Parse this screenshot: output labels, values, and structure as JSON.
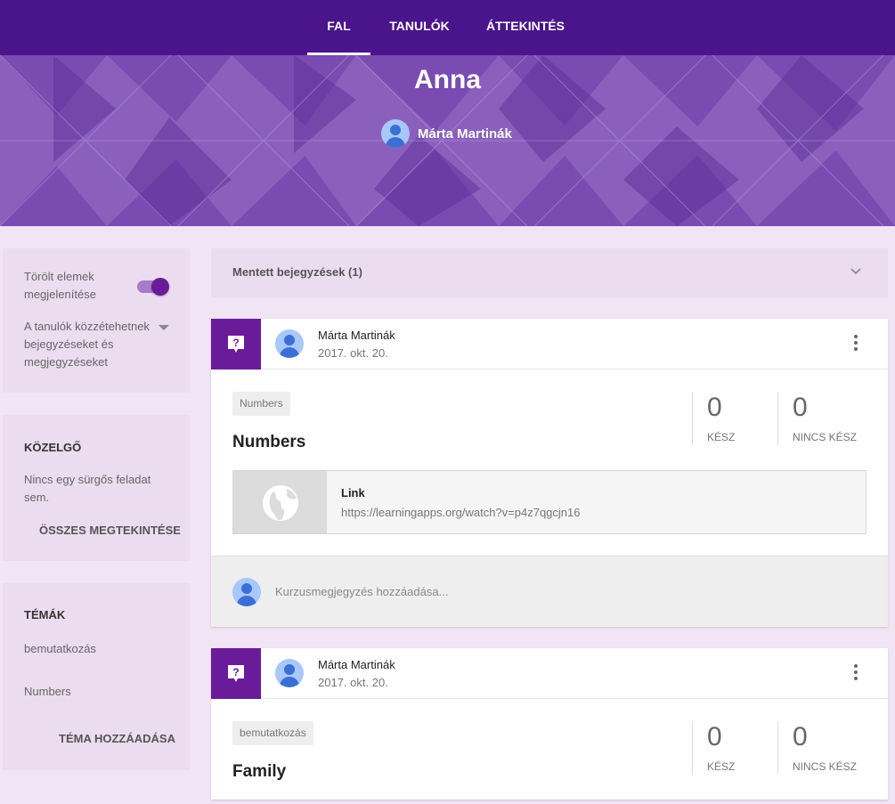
{
  "nav": {
    "tabs": [
      {
        "label": "FAL",
        "active": true
      },
      {
        "label": "TANULÓK"
      },
      {
        "label": "ÁTTEKINTÉS"
      }
    ]
  },
  "header": {
    "class_name": "Anna",
    "teacher": "Márta Martinák"
  },
  "settings": {
    "show_deleted_label": "Törölt elemek megjelenítése",
    "show_deleted_on": true,
    "permission_label": "A tanulók közzétehetnek bejegyzéseket és megjegyzéseket"
  },
  "upcoming": {
    "title": "KÖZELGŐ",
    "empty_text": "Nincs egy sürgős feladat sem.",
    "view_all": "ÖSSZES MEGTEKINTÉSE"
  },
  "topics": {
    "title": "TÉMÁK",
    "items": [
      "bemutatkozás",
      "Numbers"
    ],
    "add": "TÉMA HOZZÁADÁSA"
  },
  "saved_posts": {
    "label": "Mentett bejegyzések (1)"
  },
  "posts": [
    {
      "author": "Márta Martinák",
      "date": "2017. okt. 20.",
      "topic": "Numbers",
      "title": "Numbers",
      "done": "0",
      "done_label": "KÉSZ",
      "not_done": "0",
      "not_done_label": "NINCS KÉSZ",
      "attachment": {
        "type": "Link",
        "url": "https://learningapps.org/watch?v=p4z7qgcjn16"
      },
      "comment_placeholder": "Kurzusmegjegyzés hozzáadása..."
    },
    {
      "author": "Márta Martinák",
      "date": "2017. okt. 20.",
      "topic": "bemutatkozás",
      "title": "Family",
      "done": "0",
      "done_label": "KÉSZ",
      "not_done": "0",
      "not_done_label": "NINCS KÉSZ"
    }
  ],
  "colors": {
    "nav_bg": "#4a148c",
    "accent": "#6a1b9a",
    "page_bg": "#f1e4f5",
    "panel_bg": "#ecdcef"
  },
  "icons": {
    "question": "question-icon",
    "globe": "globe-icon",
    "more": "more-vert-icon",
    "chevron": "chevron-down-icon"
  }
}
